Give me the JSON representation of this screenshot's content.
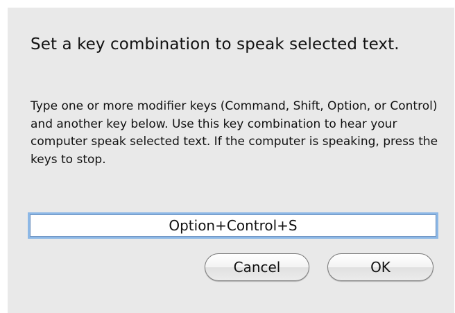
{
  "dialog": {
    "heading": "Set a key combination to speak selected text.",
    "instructions": "Type one or more modifier keys (Command, Shift, Option, or Control) and another key below. Use this key combination to hear your computer speak selected text. If the computer is speaking, press the keys to stop.",
    "key_combination_value": "Option+Control+S",
    "cancel_label": "Cancel",
    "ok_label": "OK"
  }
}
